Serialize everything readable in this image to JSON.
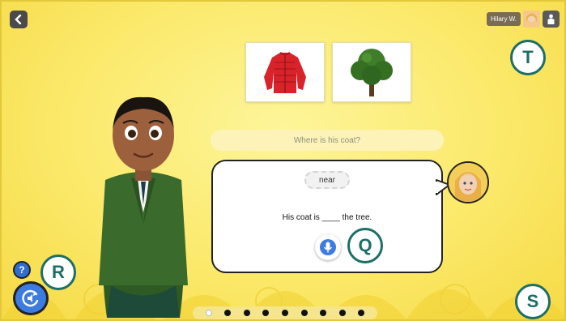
{
  "user": {
    "name": "Hilary W."
  },
  "images": [
    {
      "id": "coat",
      "icon": "red-jacket"
    },
    {
      "id": "tree",
      "icon": "green-tree"
    }
  ],
  "question": "Where is his coat?",
  "word_option": "near",
  "sentence": {
    "before": "His coat is",
    "blank": "____",
    "after": "the tree."
  },
  "badges": {
    "t": "T",
    "q": "Q",
    "r": "R",
    "s": "S"
  },
  "help_label": "?",
  "progress": {
    "total": 9,
    "current": 1
  },
  "colors": {
    "background": "#fbe96a",
    "badge": "#1c6e66",
    "button_blue": "#3c7be0",
    "jacket": "#2f5a24"
  }
}
